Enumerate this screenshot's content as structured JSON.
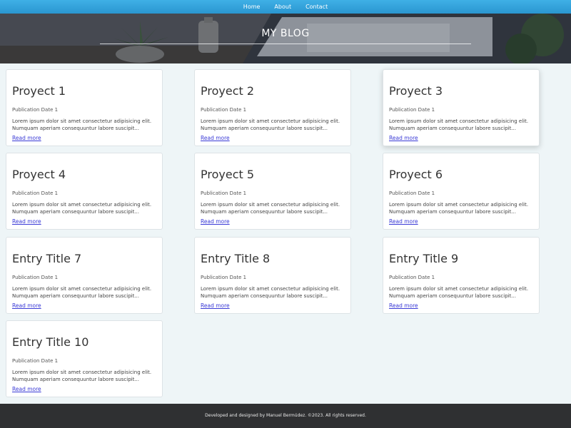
{
  "nav": {
    "items": [
      "Home",
      "About",
      "Contact"
    ]
  },
  "hero": {
    "title": "MY BLOG"
  },
  "posts": [
    {
      "title": "Proyect 1",
      "date": "Publication Date 1",
      "excerpt": "Lorem ipsum dolor sit amet consectetur adipisicing elit. Numquam aperiam consequuntur labore suscipit...",
      "link": "Read more"
    },
    {
      "title": "Proyect 2",
      "date": "Publication Date 1",
      "excerpt": "Lorem ipsum dolor sit amet consectetur adipisicing elit. Numquam aperiam consequuntur labore suscipit...",
      "link": "Read more"
    },
    {
      "title": "Proyect 3",
      "date": "Publication Date 1",
      "excerpt": "Lorem ipsum dolor sit amet consectetur adipisicing elit. Numquam aperiam consequuntur labore suscipit...",
      "link": "Read more"
    },
    {
      "title": "Proyect 4",
      "date": "Publication Date 1",
      "excerpt": "Lorem ipsum dolor sit amet consectetur adipisicing elit. Numquam aperiam consequuntur labore suscipit...",
      "link": "Read more"
    },
    {
      "title": "Proyect 5",
      "date": "Publication Date 1",
      "excerpt": "Lorem ipsum dolor sit amet consectetur adipisicing elit. Numquam aperiam consequuntur labore suscipit...",
      "link": "Read more"
    },
    {
      "title": "Proyect 6",
      "date": "Publication Date 1",
      "excerpt": "Lorem ipsum dolor sit amet consectetur adipisicing elit. Numquam aperiam consequuntur labore suscipit...",
      "link": "Read more"
    },
    {
      "title": "Entry Title 7",
      "date": "Publication Date 1",
      "excerpt": "Lorem ipsum dolor sit amet consectetur adipisicing elit. Numquam aperiam consequuntur labore suscipit...",
      "link": "Read more"
    },
    {
      "title": "Entry Title 8",
      "date": "Publication Date 1",
      "excerpt": "Lorem ipsum dolor sit amet consectetur adipisicing elit. Numquam aperiam consequuntur labore suscipit...",
      "link": "Read more"
    },
    {
      "title": "Entry Title 9",
      "date": "Publication Date 1",
      "excerpt": "Lorem ipsum dolor sit amet consectetur adipisicing elit. Numquam aperiam consequuntur labore suscipit...",
      "link": "Read more"
    },
    {
      "title": "Entry Title 10",
      "date": "Publication Date 1",
      "excerpt": "Lorem ipsum dolor sit amet consectetur adipisicing elit. Numquam aperiam consequuntur labore suscipit...",
      "link": "Read more"
    }
  ],
  "footer": {
    "text": "Developed and designed by Manuel Bermúdez. ©2023. All rights reserved."
  },
  "colors": {
    "nav_bar": "#3fb0e6",
    "link": "#3a3ad6",
    "footer_bg": "#2f3032",
    "page_bg": "#eef5f7"
  }
}
